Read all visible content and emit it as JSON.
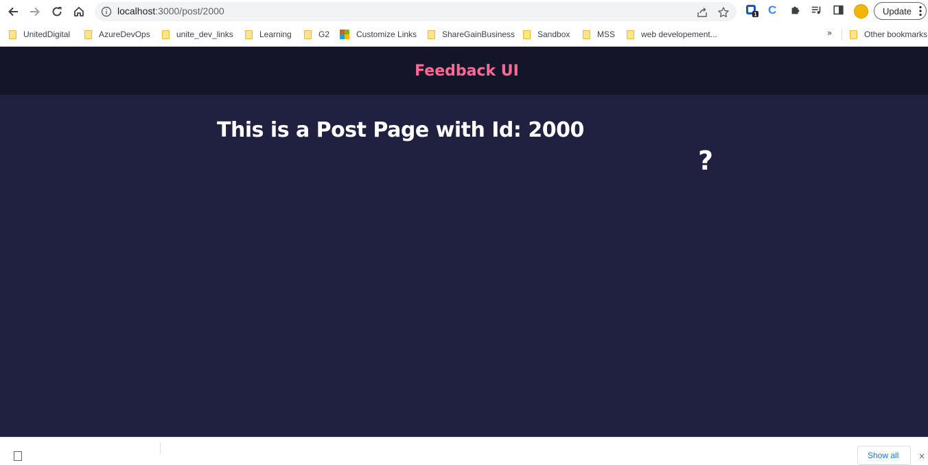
{
  "browser": {
    "url_host": "localhost",
    "url_path": ":3000/post/2000",
    "update_label": "Update",
    "extension_badge": "1",
    "extension_c_label": "C"
  },
  "bookmarks": {
    "items": [
      {
        "label": "UnitedDigital",
        "icon": "folder-icon"
      },
      {
        "label": "AzureDevOps",
        "icon": "folder-icon"
      },
      {
        "label": "unite_dev_links",
        "icon": "folder-icon"
      },
      {
        "label": "Learning",
        "icon": "folder-icon"
      },
      {
        "label": "G2",
        "icon": "folder-icon"
      },
      {
        "label": "Customize Links",
        "icon": "microsoft-logo-icon"
      },
      {
        "label": "ShareGainBusiness",
        "icon": "folder-icon"
      },
      {
        "label": "Sandbox",
        "icon": "folder-icon"
      },
      {
        "label": "MSS",
        "icon": "folder-icon"
      },
      {
        "label": "web developement...",
        "icon": "folder-icon"
      }
    ],
    "overflow_label": "»",
    "other_label": "Other bookmarks"
  },
  "app": {
    "title": "Feedback UI",
    "heading": "This is a Post Page with Id: 2000",
    "about_icon_label": "?",
    "colors": {
      "header_bg": "#15152a",
      "body_bg": "#202040",
      "title": "#ff6a95",
      "text": "#ffffff"
    }
  },
  "download_bar": {
    "show_all_label": "Show all",
    "close_label": "×"
  }
}
